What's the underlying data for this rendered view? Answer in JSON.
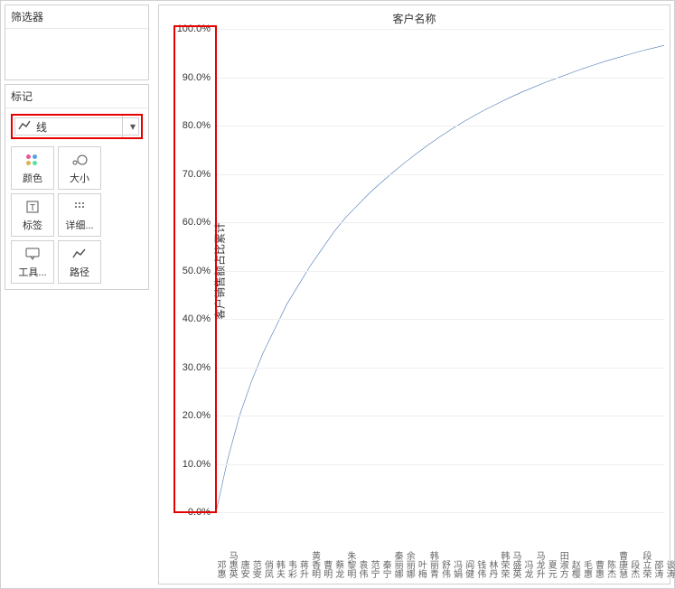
{
  "left_panel": {
    "filter_label": "筛选器",
    "marks_label": "标记",
    "mark_type": "线",
    "cells": [
      {
        "name": "color",
        "label": "颜色"
      },
      {
        "name": "size",
        "label": "大小"
      },
      {
        "name": "label",
        "label": "标签"
      },
      {
        "name": "detail",
        "label": "详细..."
      },
      {
        "name": "tooltip",
        "label": "工具..."
      },
      {
        "name": "path",
        "label": "路径"
      }
    ]
  },
  "chart_data": {
    "type": "line",
    "title": "客户名称",
    "ylabel": "客户销售额占比累计",
    "ylim": [
      0,
      100
    ],
    "yticks": [
      0,
      10,
      20,
      30,
      40,
      50,
      60,
      70,
      80,
      90,
      100
    ],
    "ytick_labels": [
      "0.0%",
      "10.0%",
      "20.0%",
      "30.0%",
      "40.0%",
      "50.0%",
      "60.0%",
      "70.0%",
      "80.0%",
      "90.0%",
      "100.0%"
    ],
    "categories": [
      "邓惠",
      "马惠英",
      "唐安",
      "范雯",
      "俏凤",
      "韩夫",
      "韦彩",
      "蒋升",
      "黄香明",
      "曹明",
      "蔡龙",
      "朱黎明",
      "袁伟",
      "范宁",
      "秦宁",
      "秦丽娜",
      "余丽娜",
      "叶梅",
      "韩丽青",
      "舒伟",
      "冯娟",
      "阎健",
      "钱伟",
      "林丹",
      "韩荣荣",
      "马盛英",
      "冯龙",
      "马龙升",
      "夏元",
      "田淑方",
      "赵樱",
      "毛惠",
      "曹惠",
      "陈杰",
      "曹康慧",
      "段杰",
      "段立荣",
      "邵涛",
      "谈涛"
    ],
    "values": [
      0,
      11,
      20,
      27,
      33,
      38,
      43,
      47,
      51,
      54.5,
      58,
      61,
      63.5,
      66,
      68.2,
      70.3,
      72.3,
      74.2,
      76,
      77.7,
      79.3,
      80.8,
      82.2,
      83.5,
      84.7,
      85.9,
      87,
      88,
      89,
      89.9,
      90.8,
      91.7,
      92.5,
      93.3,
      94,
      94.7,
      95.4,
      96,
      96.6
    ]
  }
}
